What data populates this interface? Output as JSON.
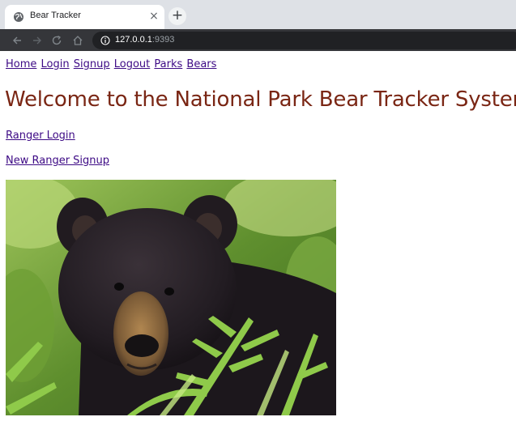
{
  "browser": {
    "tab_title": "Bear Tracker",
    "close_glyph": "×",
    "new_tab_glyph": "+",
    "url_host": "127.0.0.1",
    "url_port": ":9393"
  },
  "site_nav": {
    "links": [
      "Home",
      "Login",
      "Signup",
      "Logout",
      "Parks",
      "Bears"
    ]
  },
  "page": {
    "heading": "Welcome to the National Park Bear Tracker System!",
    "ranger_login": "Ranger Login",
    "new_ranger_signup": "New Ranger Signup",
    "photo_icon": "black-bear-photo"
  },
  "colors": {
    "link": "#3d0a85",
    "heading": "#7a2614",
    "toolbar": "#35363a",
    "tabstrip": "#dee1e6"
  }
}
